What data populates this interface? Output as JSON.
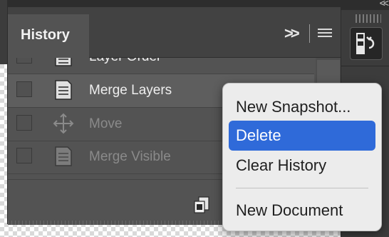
{
  "panel": {
    "tab_label": "History",
    "collapse_icon": ">>",
    "menu_icon": "hamburger-icon",
    "footer_icon": "new-document-from-state-icon"
  },
  "history": {
    "items": [
      {
        "label": "Layer Order",
        "icon": "layer-document-icon",
        "state": "normal"
      },
      {
        "label": "Merge Layers",
        "icon": "layer-document-icon",
        "state": "selected"
      },
      {
        "label": "Move",
        "icon": "move-arrows-icon",
        "state": "dimmed"
      },
      {
        "label": "Merge Visible",
        "icon": "layer-document-icon",
        "state": "dimmed"
      }
    ]
  },
  "dock": {
    "top_icon": "<<",
    "history_button_icon": "history-panel-icon"
  },
  "context_menu": {
    "items": [
      {
        "label": "New Snapshot...",
        "highlighted": false
      },
      {
        "label": "Delete",
        "highlighted": true
      },
      {
        "label": "Clear History",
        "highlighted": false
      },
      {
        "label": "New Document",
        "highlighted": false
      }
    ]
  },
  "colors": {
    "panel_bg": "#535353",
    "menu_bg": "#ececec",
    "menu_highlight": "#2f6ad9"
  }
}
